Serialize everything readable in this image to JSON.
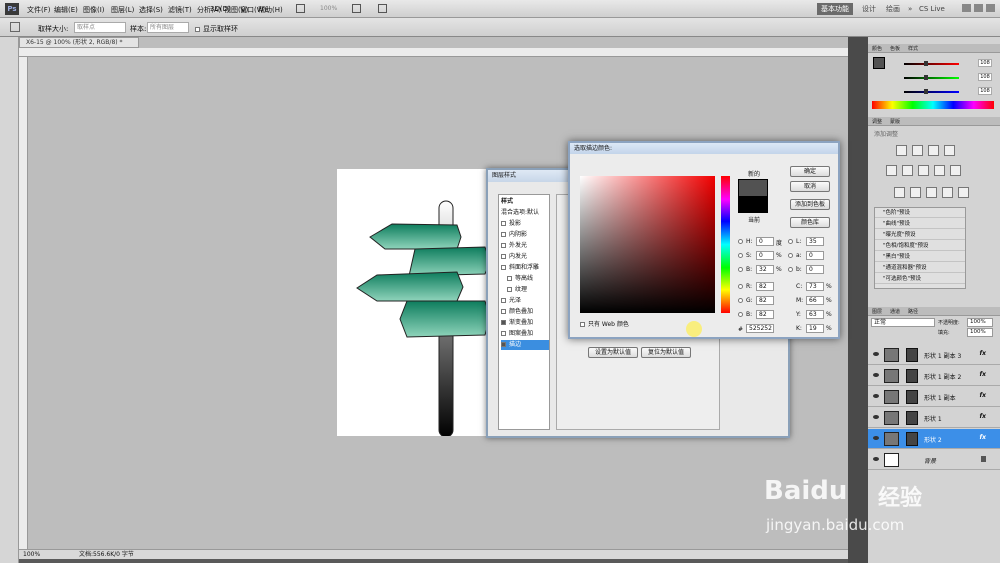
{
  "app": {
    "logo": "Ps"
  },
  "menu": [
    "文件(F)",
    "编辑(E)",
    "图像(I)",
    "图层(L)",
    "选择(S)",
    "滤镜(T)",
    "分析(A)",
    "3D(D)",
    "视图(V)",
    "窗口(W)",
    "帮助(H)"
  ],
  "zoom_menu": "100%",
  "workspace": {
    "active": "基本功能",
    "others": [
      "设计",
      "绘画"
    ],
    "more": "»",
    "search": "CS Live"
  },
  "options": {
    "sample_size_label": "取样大小:",
    "sample_size_value": "取样点",
    "sample_label": "样本:",
    "sample_value": "所有图层",
    "show_ring": "显示取样环"
  },
  "document": {
    "tab": "X6-15 @ 100% (形状 2, RGB/8) *",
    "zoom": "100%",
    "doc_info": "文档:556.6K/0 字节"
  },
  "color_panel": {
    "tabs": [
      "颜色",
      "色板",
      "样式"
    ],
    "values": [
      "108",
      "108",
      "108"
    ]
  },
  "adjust_panel": {
    "tabs": [
      "调整",
      "蒙版"
    ],
    "title": "添加调整",
    "presets": [
      "\"色阶\"预设",
      "\"曲线\"预设",
      "\"曝光度\"预设",
      "\"色相/饱和度\"预设",
      "\"黑白\"预设",
      "\"通道混和器\"预设",
      "\"可选颜色\"预设"
    ]
  },
  "layers_panel": {
    "tabs": [
      "图层",
      "通道",
      "路径"
    ],
    "blend": "正常",
    "opacity_label": "不透明度:",
    "opacity": "100%",
    "fill_label": "填充:",
    "fill": "100%",
    "layers": [
      {
        "name": "形状 1 副本 3",
        "fx": "fx"
      },
      {
        "name": "形状 1 副本 2",
        "fx": "fx"
      },
      {
        "name": "形状 1 副本",
        "fx": "fx"
      },
      {
        "name": "形状 1",
        "fx": "fx"
      },
      {
        "name": "形状 2",
        "fx": "fx"
      },
      {
        "name": "背景",
        "fx": ""
      }
    ]
  },
  "layer_style": {
    "title": "图层样式",
    "items": [
      "样式",
      "混合选项:默认",
      "投影",
      "内阴影",
      "外发光",
      "内发光",
      "斜面和浮雕",
      "等高线",
      "纹理",
      "光泽",
      "颜色叠加",
      "渐变叠加",
      "图案叠加",
      "描边"
    ],
    "checked": [
      "渐变叠加",
      "描边"
    ],
    "selected": "描边",
    "btn_default": "设置为默认值",
    "btn_reset": "复位为默认值"
  },
  "color_picker": {
    "title": "选取描边颜色:",
    "new_label": "新的",
    "current_label": "当前",
    "btn_ok": "确定",
    "btn_cancel": "取消",
    "btn_swatches": "添加到色板",
    "btn_libraries": "颜色库",
    "web_only": "只有 Web 颜色",
    "fields": {
      "H": "0",
      "S": "0",
      "B": "32",
      "R": "82",
      "G": "82",
      "Bb": "82",
      "L": "35",
      "a": "0",
      "b": "0",
      "C": "73",
      "M": "66",
      "Y": "63",
      "K": "19"
    },
    "units": {
      "H": "度",
      "pct": "%"
    },
    "hex_label": "#",
    "hex": "525252",
    "new_color": "#525252",
    "current_color": "#000000"
  },
  "watermark": {
    "brand": "Baidu",
    "brand_cn": "经验",
    "url": "jingyan.baidu.com"
  }
}
